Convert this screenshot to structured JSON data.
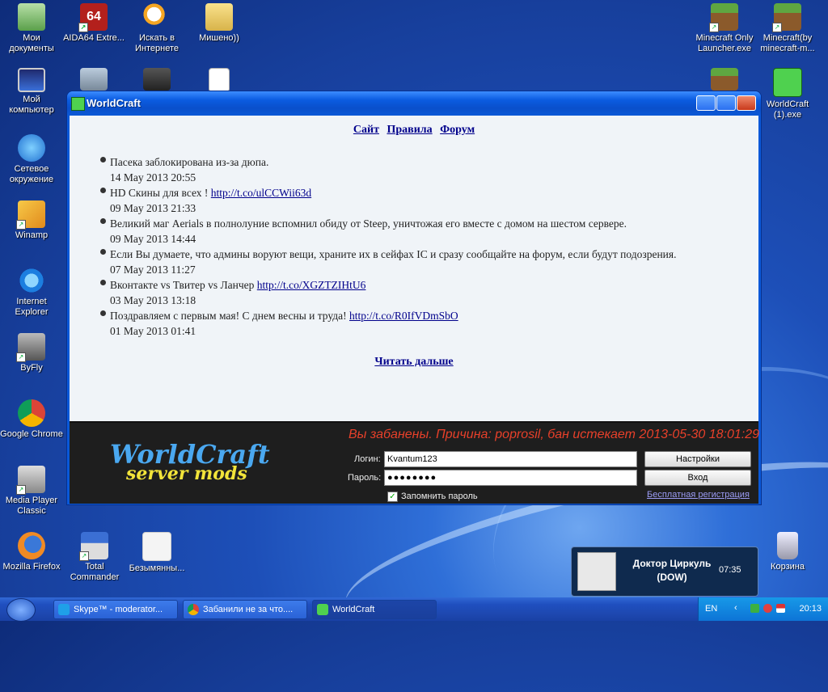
{
  "desktop": {
    "icons": [
      {
        "label": "Мои документы"
      },
      {
        "label": "AIDA64 Extre..."
      },
      {
        "label": "Искать в Интернете"
      },
      {
        "label": "Мишено))"
      },
      {
        "label": "Minecraft Only Launcher.exe"
      },
      {
        "label": "Minecraft(by minecraft-m..."
      },
      {
        "label": "Мой компьютер"
      },
      {
        "label": "WorldCraft (1).exe"
      },
      {
        "label": "Сетевое окружение"
      },
      {
        "label": "Winamp"
      },
      {
        "label": "Internet Explorer"
      },
      {
        "label": "ByFly"
      },
      {
        "label": "Google Chrome"
      },
      {
        "label": "Media Player Classic"
      },
      {
        "label": "Mozilla Firefox"
      },
      {
        "label": "Total Commander"
      },
      {
        "label": "Безымянны..."
      },
      {
        "label": "Корзина"
      }
    ]
  },
  "window": {
    "title": "WorldCraft",
    "nav": {
      "site": "Сайт",
      "rules": "Правила",
      "forum": "Форум"
    },
    "news": [
      {
        "text": "Пасека заблокирована из-за дюпа.",
        "link": "",
        "date": "14 May 2013 20:55"
      },
      {
        "text": "HD Скины для всех ! ",
        "link": "http://t.co/ulCCWii63d",
        "date": "09 May 2013 21:33"
      },
      {
        "text": "Великий маг Aerials в полнолуние вспомнил обиду от Steep, уничтожая его вместе с домом на шестом сервере.",
        "link": "",
        "date": "09 May 2013 14:44"
      },
      {
        "text": "Если Вы думаете, что админы воруют вещи, храните их в сейфах IC и сразу сообщайте на форум, если будут подозрения.",
        "link": "",
        "date": "07 May 2013 11:27"
      },
      {
        "text": "Вконтакте vs Твитер vs Ланчер ",
        "link": "http://t.co/XGZTZIHtU6",
        "date": "03 May 2013 13:18"
      },
      {
        "text": "Поздравляем с первым мая! С днем весны и труда! ",
        "link": "http://t.co/R0IfVDmSbO",
        "date": "01 May 2013 01:41"
      }
    ],
    "read_more": "Читать дальше",
    "logo_line1": "WorldCraft",
    "logo_line2": "server mods",
    "ban_message": "Вы забанены. Причина: poprosil, бан истекает 2013-05-30 18:01:29",
    "login_label": "Логин:",
    "login_value": "Kvantum123",
    "password_label": "Пароль:",
    "password_value": "●●●●●●●●",
    "settings_button": "Настройки",
    "enter_button": "Вход",
    "remember_label": "Запомнить пароль",
    "register_link": "Бесплатная регистрация"
  },
  "notification": {
    "name": "Доктор Циркуль (DOW)",
    "time": "07:35"
  },
  "taskbar": {
    "tasks": [
      {
        "label": "Skype™ - moderator..."
      },
      {
        "label": "Забанили не за что...."
      },
      {
        "label": "WorldCraft"
      }
    ],
    "lang": "EN",
    "clock": "20:13"
  },
  "colors": {
    "accent": "#0a58d8",
    "ban_text": "#e8402a",
    "link": "#00008b"
  }
}
